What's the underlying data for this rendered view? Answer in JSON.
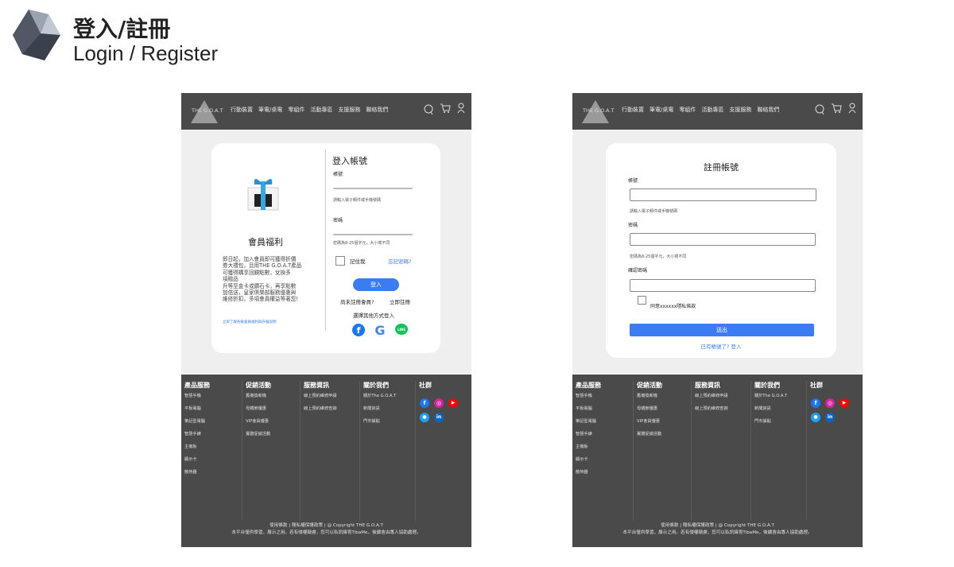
{
  "header": {
    "title_zh": "登入/註冊",
    "title_en": "Login / Register"
  },
  "nav": {
    "logo_text": "THE G.O.A.T",
    "links": [
      "行動裝置",
      "筆電/桌電",
      "零組件",
      "活動專區",
      "支援服務",
      "聯絡我們"
    ]
  },
  "login": {
    "benefit_title": "會員福利",
    "benefit_text": [
      "即日起，加入會員即可獲得折價",
      "券大禮包，且用THE G.O.A.T產品",
      "可獲得購享回饋點數，兌換多",
      "項贈品",
      "升等至金卡或鑽石卡，再享點數",
      "加倍送，皇家俱樂部服務優惠與",
      "維修折扣，多項會員權益等著您!"
    ],
    "benefit_link": "立即了解各級會員福利與升級說明",
    "heading": "登入帳號",
    "account_label": "帳號",
    "account_hint": "請輸入電子郵件或手機號碼",
    "password_label": "密碼",
    "password_hint": "密碼為8-25個字元，大小寫不同",
    "remember": "記住我",
    "forgot": "忘記密碼?",
    "submit": "登入",
    "no_account": "尚未註冊會員?",
    "register_now": "立即註冊",
    "other_methods": "選擇其他方式登入",
    "socials": [
      "facebook",
      "google",
      "line"
    ]
  },
  "register": {
    "heading": "註冊帳號",
    "account_label": "帳號",
    "account_hint": "請輸入電子郵件或手機號碼",
    "password_label": "密碼",
    "password_hint": "密碼為8-25個字元，大小寫不同",
    "confirm_label": "確認密碼",
    "agree": "同意xxxxxx隱私條款",
    "submit": "送出",
    "have_account": "已有帳號了? 登入"
  },
  "footer": {
    "columns": [
      {
        "title": "產品服務",
        "items": [
          "智慧手機",
          "平板電腦",
          "筆記型電腦",
          "智慧手錶",
          "主機板",
          "顯示卡",
          "散熱器"
        ]
      },
      {
        "title": "促銷活動",
        "items": [
          "舊機換新機",
          "母親節優惠",
          "VIP會員優惠",
          "實體促銷活動"
        ]
      },
      {
        "title": "服務資訊",
        "items": [
          "線上預約維修申請",
          "線上預約維修查詢"
        ]
      },
      {
        "title": "關於我們",
        "items": [
          "關於The G.O.A.T",
          "新聞資訊",
          "門市據點"
        ]
      },
      {
        "title": "社群",
        "items": []
      }
    ],
    "bottom_line1": "使用條款 | 隱私權保護政策 | @ Copyright THE G.O.A.T",
    "bottom_line2": "本平台僅供學習，展示之用。若有侵權疑慮，您可以私訊緯育TibaMe，後續會由專人協助處理。",
    "social_colors": {
      "facebook": "#1877f2",
      "instagram": "#d6249f",
      "youtube": "#ff0000",
      "twitter": "#1da1f2",
      "linkedin": "#0a66c2"
    }
  }
}
